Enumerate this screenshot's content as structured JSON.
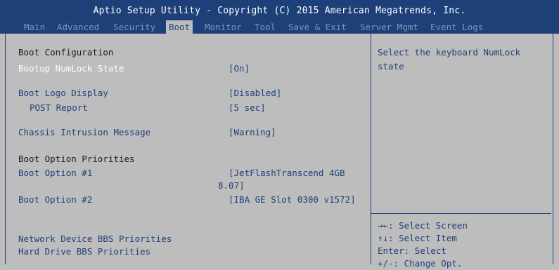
{
  "header": {
    "title": "Aptio Setup Utility - Copyright (C) 2015 American Megatrends, Inc.",
    "tabs": [
      "Main",
      "Advanced",
      "Security",
      "Boot",
      "Monitor",
      "Tool",
      "Save & Exit",
      "Server Mgmt",
      "Event Logs"
    ],
    "active_tab": "Boot"
  },
  "main": {
    "section_boot_config": "Boot Configuration",
    "items": [
      {
        "label": "Bootup NumLock State",
        "value": "[On]"
      },
      {
        "label": "Boot Logo Display",
        "value": "[Disabled]"
      },
      {
        "label": "POST Report",
        "value": "[5 sec]"
      },
      {
        "label": "Chassis Intrusion Message",
        "value": "[Warning]"
      },
      {
        "label": "Boot Option #1",
        "value_line1": "[JetFlashTranscend 4GB",
        "value_line2": "8.07]"
      },
      {
        "label": "Boot Option #2",
        "value": "[IBA GE Slot 0300 v1572]"
      },
      {
        "label": "Network Device BBS Priorities"
      },
      {
        "label": "Hard Drive BBS Priorities"
      }
    ],
    "section_boot_priorities": "Boot Option Priorities"
  },
  "help": {
    "line1": "Select the keyboard NumLock",
    "line2": "state",
    "keys": [
      "→←: Select Screen",
      "↑↓: Select Item",
      "Enter: Select",
      "+/-: Change Opt."
    ]
  },
  "colors": {
    "header_bg": "#1e4079",
    "body_bg": "#bdbdbd",
    "selected_text": "#ffffff",
    "item_text": "#1e4079"
  }
}
